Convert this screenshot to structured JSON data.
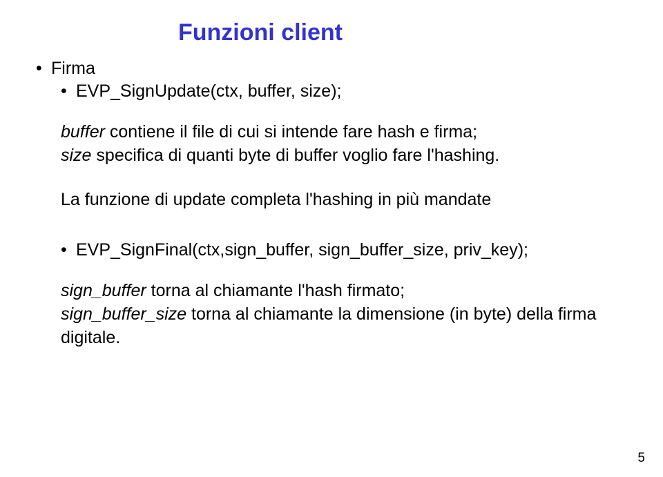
{
  "title": "Funzioni client",
  "bullet_top": "Firma",
  "bullet_sub1": "EVP_SignUpdate(ctx, buffer, size);",
  "para1_1a": "buffer",
  "para1_1b": " contiene il file di cui si intende fare hash e firma;",
  "para1_2a": "size",
  "para1_2b": " specifica di quanti byte di buffer voglio  fare l'hashing.",
  "para2": "La funzione di update completa l'hashing in più mandate",
  "bullet_sub2": "EVP_SignFinal(ctx,sign_buffer, sign_buffer_size, priv_key);",
  "para3_1a": "sign_buffer",
  "para3_1b": " torna al chiamante l'hash firmato;",
  "para3_2a": "sign_buffer_size",
  "para3_2b": " torna al chiamante la dimensione (in byte) della firma digitale.",
  "pagenum": "5"
}
